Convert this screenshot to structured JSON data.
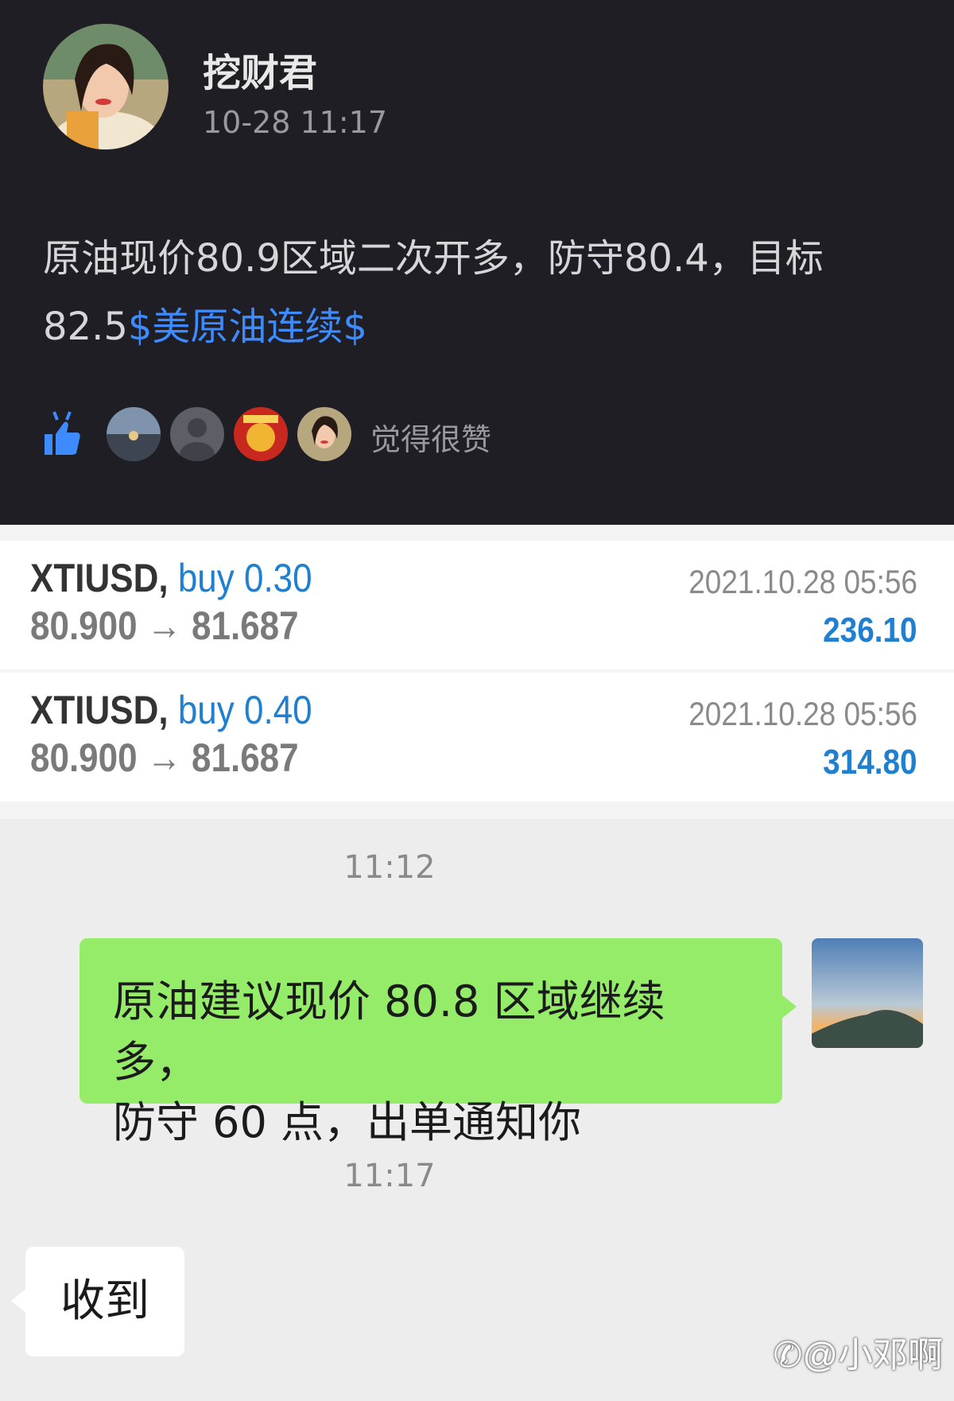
{
  "post": {
    "author": "挖财君",
    "time": "10-28 11:17",
    "text": "原油现价80.9区域二次开多，防守80.4，目标82.5",
    "tag": "$美原油连续$",
    "likes_label": "觉得很赞"
  },
  "trades": [
    {
      "symbol": "XTIUSD,",
      "side": "buy 0.30",
      "prices": "80.900 → 81.687",
      "time": "2021.10.28 05:56",
      "profit": "236.10"
    },
    {
      "symbol": "XTIUSD,",
      "side": "buy 0.40",
      "prices": "80.900 → 81.687",
      "time": "2021.10.28 05:56",
      "profit": "314.80"
    }
  ],
  "chat": {
    "time1": "11:12",
    "msg_out_line1": "原油建议现价 80.8 区域继续多，",
    "msg_out_line2": "防守 60 点，出单通知你",
    "time2": "11:17",
    "msg_in": "收到"
  },
  "watermark": "@小邓啊",
  "colors": {
    "dark_bg": "#1e1e24",
    "tag_blue": "#3d8bff",
    "trade_blue": "#1f7fd0",
    "bubble_green": "#95ec69"
  }
}
